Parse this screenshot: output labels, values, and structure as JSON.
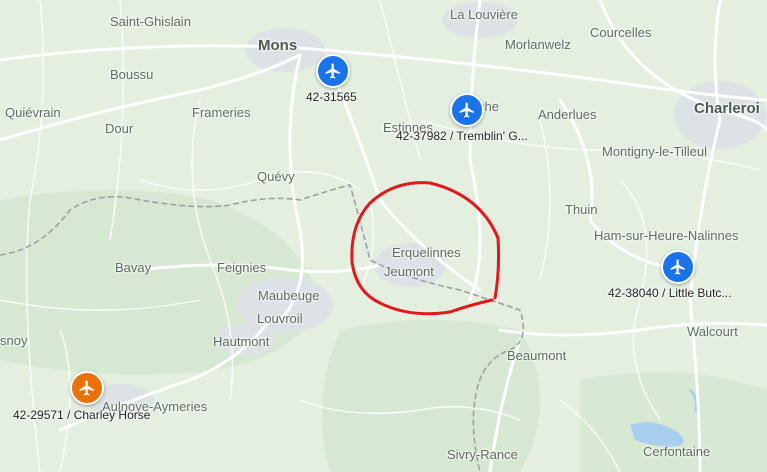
{
  "towns": {
    "saint_ghislain": "Saint-Ghislain",
    "la_louviere": "La Louvière",
    "mons": "Mons",
    "morlanwelz": "Morlanwelz",
    "courcelles": "Courcelles",
    "boussu": "Boussu",
    "quievrain": "Quiévrain",
    "frameries": "Frameries",
    "anderlues": "Anderlues",
    "charleroi": "Charleroi",
    "dour": "Dour",
    "estinnes": "Estinnes",
    "binche_partial": "che",
    "montigny": "Montigny-le-Tilleul",
    "quevy": "Quévy",
    "thuin": "Thuin",
    "ham_sur_heure": "Ham-sur-Heure-Nalinnes",
    "bavay": "Bavay",
    "feignies": "Feignies",
    "erquelinnes": "Erquelinnes",
    "jeumont": "Jeumont",
    "maubeuge": "Maubeuge",
    "louvroil": "Louvroil",
    "hautmont": "Hautmont",
    "walcourt": "Walcourt",
    "beaumont": "Beaumont",
    "sars_partial": "snoy",
    "aulnoye": "Aulnoye-Aymeries",
    "sivry_rance": "Sivry-Rance",
    "cerfontaine": "Cerfontaine"
  },
  "airfields": [
    {
      "label": "42-31565",
      "color": "#1a73e8",
      "icon": "airplane-icon"
    },
    {
      "label": "42-37982 / Tremblin' G...",
      "color": "#1a73e8",
      "icon": "airplane-icon"
    },
    {
      "label": "42-38040 / Little Butc...",
      "color": "#1a73e8",
      "icon": "airplane-icon"
    },
    {
      "label": "42-29571 / Charley Horse",
      "color": "#e8710a",
      "icon": "airplane-icon"
    }
  ],
  "colors": {
    "land": "#e4efe0",
    "road": "#ffffff",
    "border": "#9aa0a6",
    "urban": "#dde2e6",
    "water": "#a8cff0",
    "annotation_circle": "#e0191e"
  }
}
